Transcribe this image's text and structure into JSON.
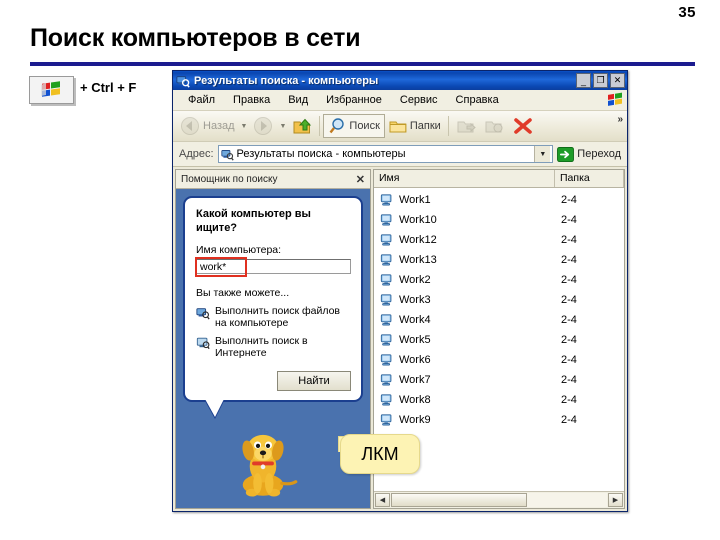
{
  "slide": {
    "page_number": "35",
    "title": "Поиск компьютеров в сети",
    "shortcut_hint": "+ Ctrl + F",
    "winkey_icon": "windows-logo-icon",
    "accent_rule_color": "#1b1b8f"
  },
  "window": {
    "title": "Результаты поиска - компьютеры",
    "title_icon": "search-computers-icon",
    "buttons": {
      "minimize": "_",
      "maximize": "❐",
      "close": "✕"
    },
    "menu": [
      {
        "label": "Файл",
        "accel": "Ф"
      },
      {
        "label": "Правка",
        "accel": "П"
      },
      {
        "label": "Вид",
        "accel": "В"
      },
      {
        "label": "Избранное",
        "accel": "И"
      },
      {
        "label": "Сервис",
        "accel": "С"
      },
      {
        "label": "Справка",
        "accel": "С"
      }
    ],
    "toolbar": {
      "back_label": "Назад",
      "forward_label": "",
      "up_label": "",
      "search_label": "Поиск",
      "folders_label": "Папки",
      "overflow_label": "»",
      "icons": [
        "back-arrow-icon",
        "forward-arrow-icon",
        "up-folder-icon",
        "search-magnifier-icon",
        "folders-icon",
        "move-to-folder-icon",
        "copy-to-folder-icon",
        "delete-x-icon"
      ]
    },
    "address": {
      "label": "Адрес:",
      "value": "Результаты поиска - компьютеры",
      "icon": "search-computers-icon",
      "dropdown_icon": "chevron-down-icon",
      "go_label": "Переход",
      "go_icon": "green-arrow-icon"
    }
  },
  "search_pane": {
    "header_title": "Помощник по поиску",
    "close_icon": "close-icon",
    "question": "Какой компьютер вы ищите?",
    "field_label": "Имя компьютера:",
    "field_label_accel": "к",
    "field_value": "work*",
    "field_placeholder": "",
    "highlight_color": "#e03020",
    "also_can_label": "Вы также можете...",
    "links": [
      {
        "text": "Выполнить поиск файлов на компьютере",
        "accel": "ю",
        "icon": "search-files-icon"
      },
      {
        "text": "Выполнить поиск в Интернете",
        "accel": "т",
        "icon": "search-internet-icon"
      }
    ],
    "find_button": "Найти",
    "find_button_accel": "й",
    "assistant_icon": "search-dog-icon"
  },
  "results": {
    "columns": [
      "Имя",
      "Папка"
    ],
    "row_icon": "computer-icon",
    "rows": [
      {
        "name": "Work1",
        "folder": "2-4"
      },
      {
        "name": "Work10",
        "folder": "2-4"
      },
      {
        "name": "Work12",
        "folder": "2-4"
      },
      {
        "name": "Work13",
        "folder": "2-4"
      },
      {
        "name": "Work2",
        "folder": "2-4"
      },
      {
        "name": "Work3",
        "folder": "2-4"
      },
      {
        "name": "Work4",
        "folder": "2-4"
      },
      {
        "name": "Work5",
        "folder": "2-4"
      },
      {
        "name": "Work6",
        "folder": "2-4"
      },
      {
        "name": "Work7",
        "folder": "2-4"
      },
      {
        "name": "Work8",
        "folder": "2-4"
      },
      {
        "name": "Work9",
        "folder": "2-4"
      }
    ],
    "hscroll_left_icon": "arrow-left-icon",
    "hscroll_right_icon": "arrow-right-icon"
  },
  "callout": {
    "text": "ЛКМ",
    "background": "#fdf3b4"
  }
}
